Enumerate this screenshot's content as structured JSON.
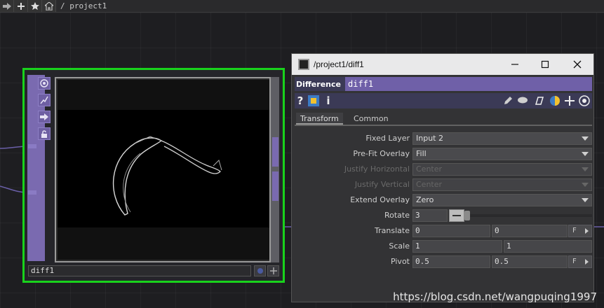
{
  "toolbar": {
    "breadcrumb": "/ project1",
    "icons": [
      "arrow-right-icon",
      "plus-icon",
      "star-icon",
      "home-icon"
    ]
  },
  "node": {
    "name": "diff1",
    "border_color": "#19d21c",
    "side_icons": [
      "viewer-icon",
      "bypass-icon",
      "export-icon",
      "lock-icon"
    ]
  },
  "param_window": {
    "title": "/project1/diff1",
    "op_type": "Difference",
    "op_name": "diff1",
    "help_glyphs": [
      "?",
      "i"
    ],
    "tabs": [
      {
        "label": "Transform",
        "active": true
      },
      {
        "label": "Common",
        "active": false
      }
    ],
    "params": {
      "fixed_layer": {
        "label": "Fixed Layer",
        "value": "Input 2"
      },
      "prefit_overlay": {
        "label": "Pre-Fit Overlay",
        "value": "Fill"
      },
      "justify_h": {
        "label": "Justify Horizontal",
        "value": "Center",
        "enabled": false
      },
      "justify_v": {
        "label": "Justify Vertical",
        "value": "Center",
        "enabled": false
      },
      "extend_overlay": {
        "label": "Extend Overlay",
        "value": "Zero"
      },
      "rotate": {
        "label": "Rotate",
        "value": "3"
      },
      "translate": {
        "label": "Translate",
        "x": "0",
        "y": "0",
        "unit": "F"
      },
      "scale": {
        "label": "Scale",
        "x": "1",
        "y": "1"
      },
      "pivot": {
        "label": "Pivot",
        "x": "0.5",
        "y": "0.5",
        "unit": "F"
      }
    }
  },
  "watermark": "https://blog.csdn.net/wangpuqing1997"
}
